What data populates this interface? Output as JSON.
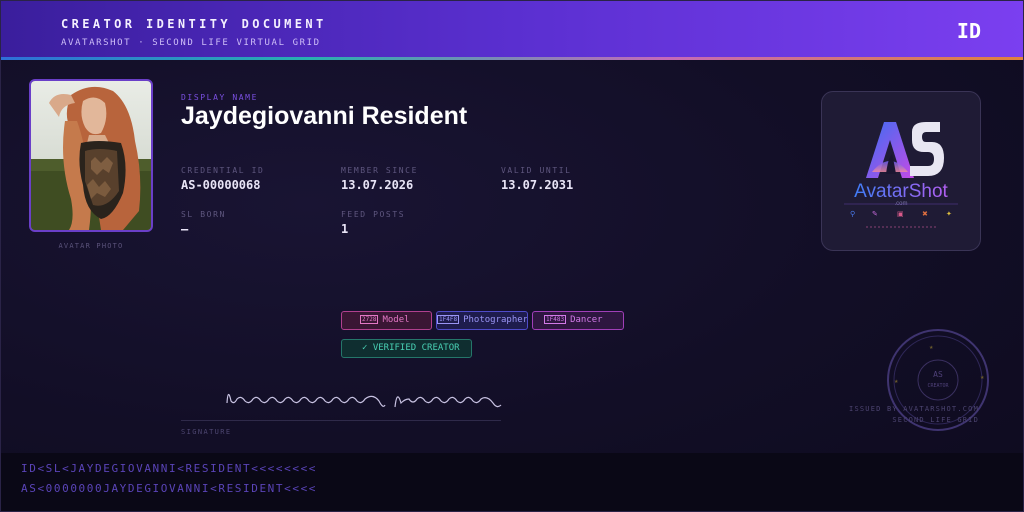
{
  "header": {
    "title": "CREATOR IDENTITY DOCUMENT",
    "subtitle": "AVATARSHOT · SECOND LIFE VIRTUAL GRID",
    "badge": "ID"
  },
  "photo": {
    "caption": "AVATAR PHOTO"
  },
  "identity": {
    "display_name_label": "DISPLAY NAME",
    "display_name": "Jaydegiovanni Resident",
    "fields": [
      {
        "label": "CREDENTIAL ID",
        "value": "AS-00000068"
      },
      {
        "label": "MEMBER SINCE",
        "value": "13.07.2026"
      },
      {
        "label": "VALID UNTIL",
        "value": "13.07.2031"
      },
      {
        "label": "SL BORN",
        "value": "—"
      },
      {
        "label": "FEED POSTS",
        "value": "1"
      }
    ]
  },
  "logo": {
    "brand": "AvatarShot",
    "domain": ".com"
  },
  "tags": [
    {
      "code": "2728",
      "label": "Model"
    },
    {
      "code": "1F4F8",
      "label": "Photographer"
    },
    {
      "code": "1F483",
      "label": "Dancer"
    }
  ],
  "verified": "✓ VERIFIED CREATOR",
  "signature": {
    "label": "SIGNATURE"
  },
  "seal": {
    "issued_line1": "ISSUED BY AVATARSHOT.COM",
    "issued_line2": "SECOND LIFE GRID"
  },
  "mrz": {
    "line1": "ID<SL<JAYDEGIOVANNI<RESIDENT<<<<<<<<",
    "line2": "AS<0000000JAYDEGIOVANNI<RESIDENT<<<<"
  },
  "colors": {
    "accent": "#7b3ff0",
    "verified": "#49d0b4"
  }
}
